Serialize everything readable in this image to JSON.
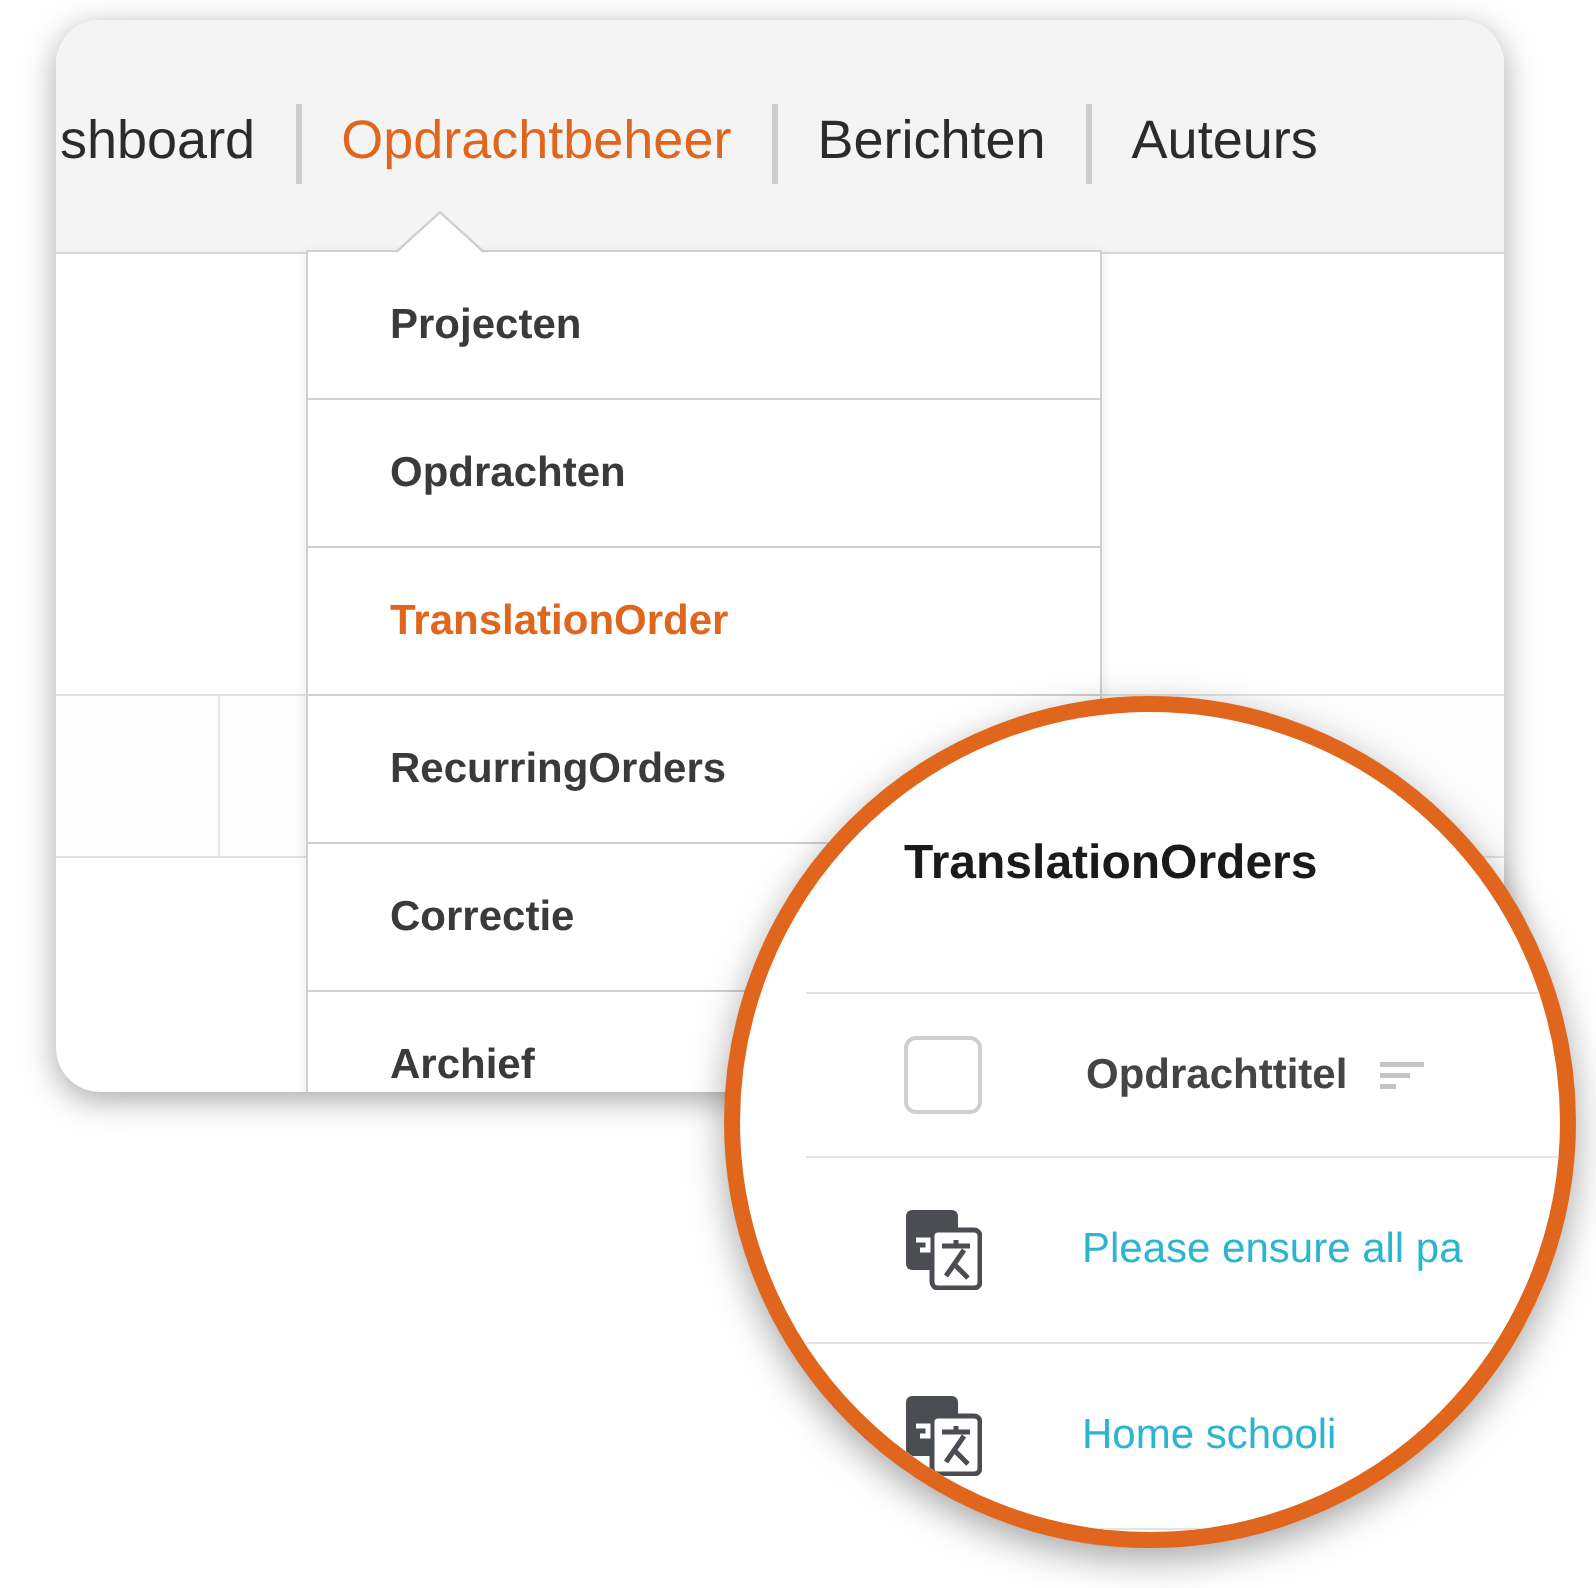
{
  "nav": {
    "items": [
      {
        "label": "shboard",
        "selected": false
      },
      {
        "label": "Opdrachtbeheer",
        "selected": true
      },
      {
        "label": "Berichten",
        "selected": false
      },
      {
        "label": "Auteurs",
        "selected": false
      }
    ]
  },
  "dropdown": {
    "items": [
      {
        "label": "Projecten",
        "selected": false
      },
      {
        "label": "Opdrachten",
        "selected": false
      },
      {
        "label": "TranslationOrder",
        "selected": true
      },
      {
        "label": "RecurringOrders",
        "selected": false
      },
      {
        "label": "Correctie",
        "selected": false
      },
      {
        "label": "Archief",
        "selected": false
      }
    ]
  },
  "magnifier": {
    "title": "TranslationOrders",
    "table": {
      "header": {
        "checked": false,
        "column": "Opdrachttitel"
      },
      "rows": [
        {
          "title": "Please ensure all pa"
        },
        {
          "title": "Home schooli"
        }
      ]
    }
  }
}
